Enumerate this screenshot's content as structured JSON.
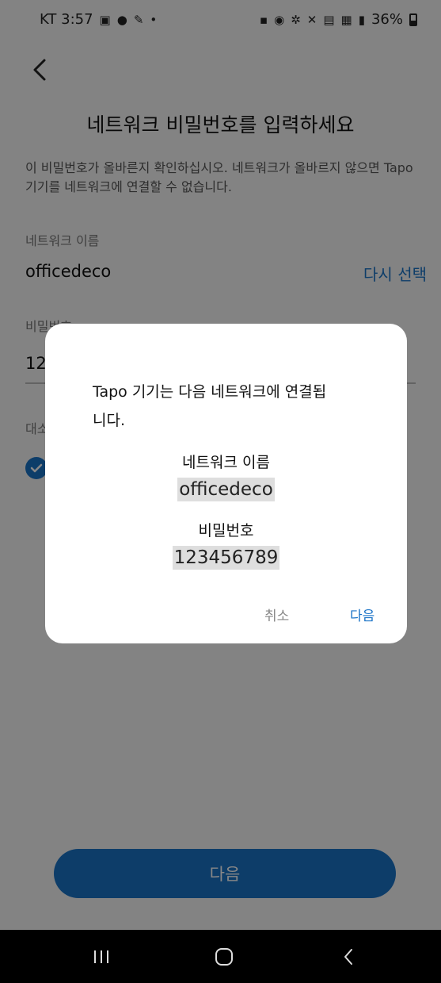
{
  "status_bar": {
    "carrier_time": "KT 3:57",
    "left_icons": [
      "gallery-icon",
      "talk-icon",
      "notification-icon",
      "dot-icon"
    ],
    "right_icons": [
      "lock-icon",
      "alarm-icon",
      "bluetooth-icon",
      "mute-icon",
      "hd-icon",
      "5g-icon",
      "signal-icon"
    ],
    "battery": "36%"
  },
  "page": {
    "title": "네트워크 비밀번호를 입력하세요",
    "description": "이 비밀번호가 올바른지 확인하십시오. 네트워크가 올바르지 않으면 Tapo 기기를 네트워크에 연결할 수 없습니다.",
    "network_label": "네트워크 이름",
    "network_name": "officedeco",
    "reselect": "다시 선택",
    "password_label": "비밀번호",
    "password_value": "12",
    "case_label": "대소",
    "next_button": "다음"
  },
  "dialog": {
    "message": "Tapo 기기는 다음 네트워크에 연결됩니다.",
    "network_label": "네트워크 이름",
    "network_value": "officedeco",
    "password_label": "비밀번호",
    "password_value": "123456789",
    "cancel": "취소",
    "next": "다음"
  },
  "colors": {
    "accent": "#1a73c7",
    "scrim": "#000000",
    "nav_bar": "#000000"
  }
}
